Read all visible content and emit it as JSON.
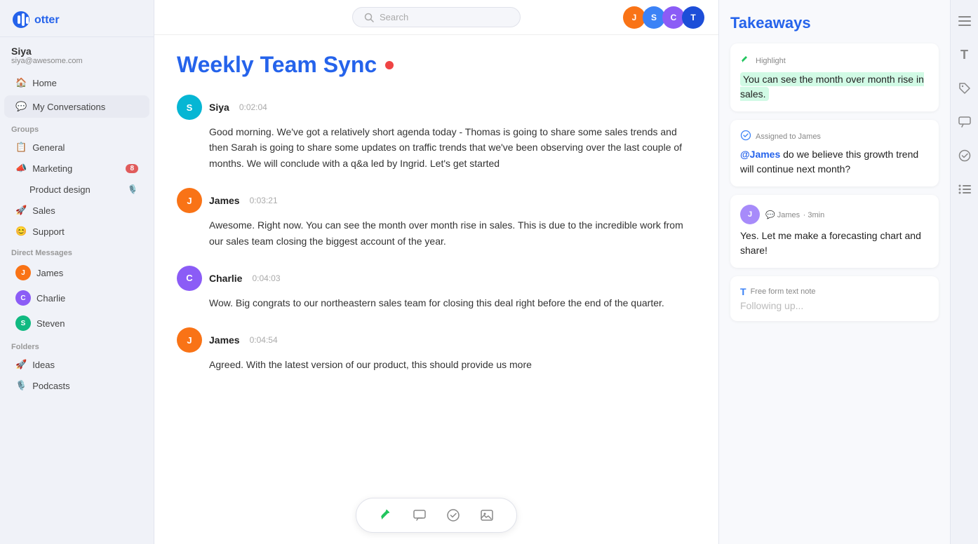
{
  "sidebar": {
    "logo_alt": "Otter.ai logo",
    "user": {
      "name": "Siya",
      "email": "siya@awesome.com"
    },
    "nav": [
      {
        "id": "home",
        "label": "Home",
        "icon": "🏠"
      },
      {
        "id": "my-conversations",
        "label": "My Conversations",
        "icon": "💬"
      }
    ],
    "groups_title": "Groups",
    "groups": [
      {
        "id": "general",
        "label": "General",
        "icon": "📋",
        "badge": null
      },
      {
        "id": "marketing",
        "label": "Marketing",
        "icon": "📣",
        "badge": "8"
      },
      {
        "id": "product-design",
        "label": "Product design",
        "icon": null,
        "badge": null,
        "sub": true,
        "mic": true
      },
      {
        "id": "sales",
        "label": "Sales",
        "icon": "🚀",
        "badge": null
      },
      {
        "id": "support",
        "label": "Support",
        "icon": "😊",
        "badge": null
      }
    ],
    "dm_title": "Direct Messages",
    "dms": [
      {
        "id": "james",
        "label": "James",
        "color": "av-james",
        "initials": "J"
      },
      {
        "id": "charlie",
        "label": "Charlie",
        "color": "av-charlie",
        "initials": "C"
      },
      {
        "id": "steven",
        "label": "Steven",
        "color": "av-steven",
        "initials": "S"
      }
    ],
    "folders_title": "Folders",
    "folders": [
      {
        "id": "ideas",
        "label": "Ideas",
        "icon": "🚀"
      },
      {
        "id": "podcasts",
        "label": "Podcasts",
        "icon": "🎙️"
      }
    ]
  },
  "topbar": {
    "search_placeholder": "Search"
  },
  "chat": {
    "title": "Weekly Team Sync",
    "recording": true,
    "messages": [
      {
        "id": "msg1",
        "sender": "Siya",
        "time": "0:02:04",
        "avatar_color": "av-siya",
        "avatar_initials": "S",
        "text": "Good morning. We've got a relatively short agenda today - Thomas is going to share some sales trends and then Sarah is going to share some updates on traffic trends that we've been observing over the last couple of months. We will conclude with a q&a led by Ingrid. Let's get started"
      },
      {
        "id": "msg2",
        "sender": "James",
        "time": "0:03:21",
        "avatar_color": "av-james",
        "avatar_initials": "J",
        "text": "Awesome. Right now. You can see the month over month rise in sales. This is due to the incredible work from our sales team closing the biggest account of the year."
      },
      {
        "id": "msg3",
        "sender": "Charlie",
        "time": "0:04:03",
        "avatar_color": "av-charlie",
        "avatar_initials": "C",
        "text": "Wow. Big congrats to our northeastern sales team for closing this deal right before the end of the quarter."
      },
      {
        "id": "msg4",
        "sender": "James",
        "time": "0:04:54",
        "avatar_color": "av-james",
        "avatar_initials": "J",
        "text": "Agreed. With the latest version of our product, this should provide us more"
      }
    ],
    "toolbar": {
      "highlight_icon": "highlight",
      "comment_icon": "comment",
      "action_icon": "action",
      "image_icon": "image"
    }
  },
  "takeaways": {
    "title": "Takeaways",
    "cards": [
      {
        "id": "card1",
        "type": "Highlight",
        "type_icon": "highlight",
        "text": "You can see the month over month rise in sales.",
        "highlighted": true
      },
      {
        "id": "card2",
        "type": "Assigned to James",
        "type_icon": "assigned",
        "mention": "@James",
        "text": " do we believe this growth trend will continue next month?"
      },
      {
        "id": "card3",
        "type": "reply",
        "avatar_initials": "J",
        "sender": "James",
        "time_ago": "3min",
        "text": "Yes. Let me make a forecasting chart and share!"
      },
      {
        "id": "card4",
        "type": "Free form text note",
        "type_icon": "T",
        "placeholder_text": "Following up..."
      }
    ]
  },
  "right_icons": [
    {
      "id": "text-icon",
      "symbol": "≡"
    },
    {
      "id": "font-icon",
      "symbol": "T"
    },
    {
      "id": "tag-icon",
      "symbol": "🏷"
    },
    {
      "id": "comment-icon",
      "symbol": "💬"
    },
    {
      "id": "check-icon",
      "symbol": "✓"
    },
    {
      "id": "list-icon",
      "symbol": "≔"
    }
  ]
}
